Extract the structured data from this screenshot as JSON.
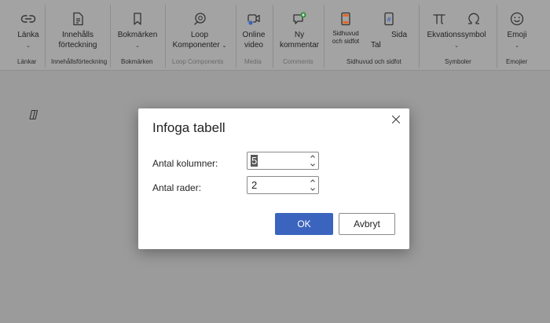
{
  "ribbon": {
    "links": {
      "label": "Länka",
      "group": "Länkar"
    },
    "toc": {
      "label_line1": "Innehålls",
      "label_line2": "förteckning",
      "group": "Innehållsförteckning"
    },
    "bookmarks": {
      "label": "Bokmärken",
      "group": "Bokmärken"
    },
    "loop": {
      "label_line1": "Loop",
      "label_line2": "Komponenter",
      "group": "Loop Components"
    },
    "media": {
      "label_line1": "Online",
      "label_line2": "video",
      "group": "Media"
    },
    "comments": {
      "label_line1": "Ny",
      "label_line2": "kommentar",
      "group": "Comments"
    },
    "header_footer": {
      "header_line1": "Sidhuvud",
      "header_line2": "och sidfot",
      "page_line1": "Sida",
      "page_line2": "Tal",
      "group": "Sidhuvud och sidfot"
    },
    "symbols": {
      "equation": "Ekvationssymbol",
      "group": "Symboler"
    },
    "emoji": {
      "label": "Emoji",
      "group": "Emojier"
    }
  },
  "dialog": {
    "title": "Infoga tabell",
    "columns_label": "Antal kolumner:",
    "columns_value": "5",
    "rows_label": "Antal rader:",
    "rows_value": "2",
    "ok_label": "OK",
    "cancel_label": "Avbryt"
  },
  "icons": [
    "link-icon",
    "toc-icon",
    "bookmark-icon",
    "loop-icon",
    "video-icon",
    "comment-icon",
    "header-icon",
    "page-number-icon",
    "pi-icon",
    "omega-icon",
    "emoji-icon",
    "copilot-icon",
    "close-icon"
  ],
  "colors": {
    "accent": "#3b64bf",
    "overlay": "#9b9b9b",
    "dialog_bg": "#ffffff"
  }
}
